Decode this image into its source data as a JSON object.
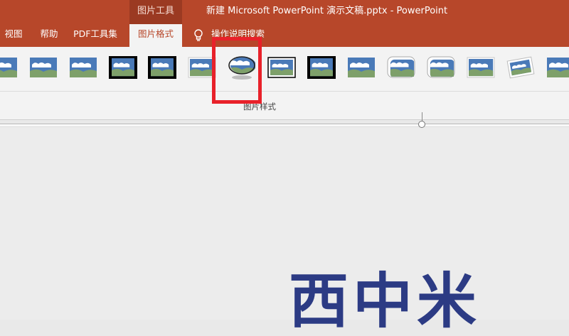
{
  "titlebar": {
    "context_tab_group": "图片工具",
    "doc_title": "新建 Microsoft PowerPoint 演示文稿.pptx  -  PowerPoint"
  },
  "tabs": [
    {
      "label": "视图"
    },
    {
      "label": "帮助"
    },
    {
      "label": "PDF工具集"
    },
    {
      "label": "图片格式",
      "active": true
    }
  ],
  "tell_me": {
    "label": "操作说明搜索",
    "icon": "lightbulb-icon"
  },
  "ribbon": {
    "group_label": "图片样式",
    "gallery_items": [
      {
        "style": "plain",
        "icon": "picture-style-thumbnail"
      },
      {
        "style": "soft-reflect",
        "icon": "picture-style-thumbnail"
      },
      {
        "style": "soft-edge",
        "icon": "picture-style-thumbnail"
      },
      {
        "style": "thick-black-frame",
        "icon": "picture-style-thumbnail"
      },
      {
        "style": "black-matte",
        "icon": "picture-style-thumbnail"
      },
      {
        "style": "shadow",
        "icon": "picture-style-thumbnail"
      },
      {
        "style": "oval-reflected",
        "icon": "picture-style-thumbnail",
        "highlighted": true
      },
      {
        "style": "double-frame",
        "icon": "picture-style-thumbnail"
      },
      {
        "style": "thick-matte-black",
        "icon": "picture-style-thumbnail"
      },
      {
        "style": "soft-edge-rect",
        "icon": "picture-style-thumbnail"
      },
      {
        "style": "rounded-rect",
        "icon": "picture-style-thumbnail"
      },
      {
        "style": "rounded-shadow",
        "icon": "picture-style-thumbnail"
      },
      {
        "style": "simple-frame-white",
        "icon": "picture-style-thumbnail"
      },
      {
        "style": "rotated-white",
        "icon": "picture-style-thumbnail"
      },
      {
        "style": "perspective",
        "icon": "picture-style-thumbnail"
      }
    ]
  },
  "slide": {
    "text": "西中米"
  },
  "colors": {
    "accent": "#b7472a",
    "context_group": "#9b3a22",
    "highlight_box": "#e8212a",
    "slide_text": "#2c3b84"
  }
}
